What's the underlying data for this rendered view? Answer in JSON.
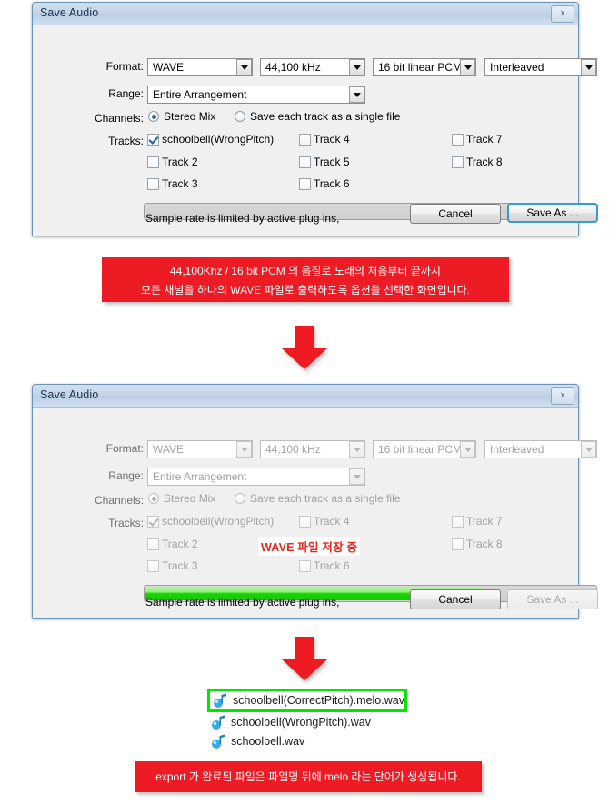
{
  "dialog1": {
    "title": "Save Audio",
    "close_label": "✕",
    "labels": {
      "format": "Format:",
      "range": "Range:",
      "channels": "Channels:",
      "tracks": "Tracks:"
    },
    "combos": {
      "format": "WAVE",
      "samplerate": "44,100 kHz",
      "bitdepth": "16 bit linear PCM",
      "interleave": "Interleaved",
      "range": "Entire Arrangement"
    },
    "channels": {
      "stereo_mix": "Stereo Mix",
      "each_track": "Save each track as a single file"
    },
    "tracks": {
      "col1": [
        "schoolbell(WrongPitch)",
        "Track 2",
        "Track 3"
      ],
      "col2": [
        "Track 4",
        "Track 5",
        "Track 6"
      ],
      "col3": [
        "Track 7",
        "Track 8"
      ]
    },
    "progress_percent": 0,
    "footnote": "Sample rate is limited by active plug ins,",
    "cancel_label": "Cancel",
    "saveas_label": "Save As ..."
  },
  "callout1": {
    "line1": "44,100Khz / 16 bit PCM 의 음질로 노래의 처음부터 끝까지",
    "line2": "모든 채널을 하나의 WAVE 파일로 출력하도록 옵션을 선택한 화면입니다."
  },
  "dialog2": {
    "title": "Save Audio",
    "close_label": "✕",
    "labels": {
      "format": "Format:",
      "range": "Range:",
      "channels": "Channels:",
      "tracks": "Tracks:"
    },
    "combos": {
      "format": "WAVE",
      "samplerate": "44,100 kHz",
      "bitdepth": "16 bit linear PCM",
      "interleave": "Interleaved",
      "range": "Entire Arrangement"
    },
    "channels": {
      "stereo_mix": "Stereo Mix",
      "each_track": "Save each track as a single file"
    },
    "tracks": {
      "col1": [
        "schoolbell(WrongPitch)",
        "Track 2",
        "Track 3"
      ],
      "col2": [
        "Track 4",
        "Track 5",
        "Track 6"
      ],
      "col3": [
        "Track 7",
        "Track 8"
      ]
    },
    "saving_status": "WAVE 파일 저장 중",
    "progress_percent": 75,
    "footnote": "Sample rate is limited by active plug ins,",
    "cancel_label": "Cancel",
    "saveas_label": "Save As ..."
  },
  "files": [
    {
      "name": "schoolbell(CorrectPitch).melo.wav",
      "icon": "music-note-icon",
      "highlighted": true
    },
    {
      "name": "schoolbell(WrongPitch).wav",
      "icon": "music-note-icon",
      "highlighted": false
    },
    {
      "name": "schoolbell.wav",
      "icon": "music-note-icon",
      "highlighted": false
    }
  ],
  "callout2": {
    "line1": "export 가 완료된 파일은 파일명 뒤에 melo 라는 단어가 생성됩니다."
  },
  "colors": {
    "callout_bg": "#ed1c24",
    "highlight_border": "#00e800",
    "progress_fill": "#18d400",
    "arrow": "#ee1b23",
    "titlebar": "#c4d6e8"
  }
}
